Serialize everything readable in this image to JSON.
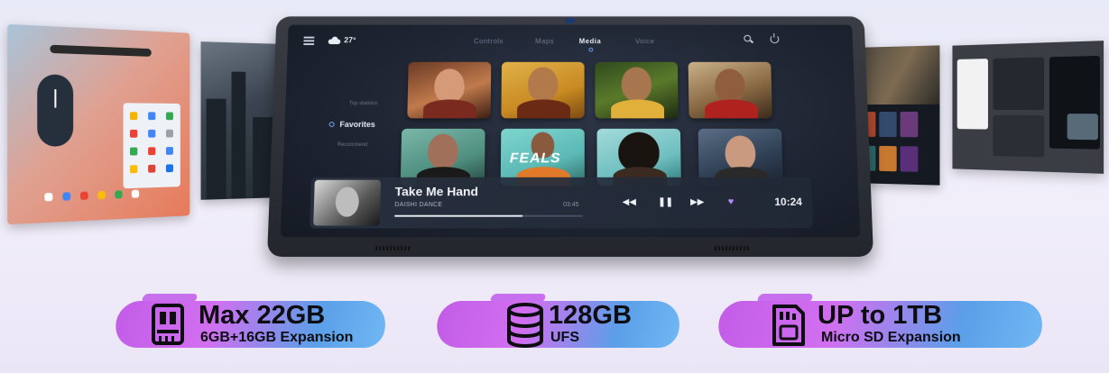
{
  "tablet": {
    "status": {
      "temperature": "27°"
    },
    "tabs": [
      {
        "label": "Controls"
      },
      {
        "label": "Maps"
      },
      {
        "label": "Media"
      },
      {
        "label": "Voice"
      }
    ],
    "active_tab": "Media",
    "nav": [
      {
        "label": "Top stations"
      },
      {
        "label": "Favorites"
      },
      {
        "label": "Recommend"
      }
    ],
    "active_nav": "Favorites",
    "albums": [
      {
        "caption": ""
      },
      {
        "caption": ""
      },
      {
        "caption": ""
      },
      {
        "caption": ""
      },
      {
        "caption": ""
      },
      {
        "caption": "FEALS"
      },
      {
        "caption": ""
      },
      {
        "caption": ""
      }
    ],
    "now_playing": {
      "title": "Take Me Hand",
      "artist": "DAISHI DANCE",
      "time": "03:45",
      "progress_fraction": 0.68,
      "clock": "10:24"
    },
    "icons": [
      "menu-icon",
      "weather-icon",
      "search-icon",
      "power-icon",
      "previous-icon",
      "pause-icon",
      "next-icon",
      "heart-icon"
    ]
  },
  "specs": [
    {
      "main": "Max 22GB",
      "sub": "6GB+16GB Expansion",
      "icon": "ram-chip-icon"
    },
    {
      "main": "128GB",
      "sub": "UFS",
      "icon": "storage-database-icon"
    },
    {
      "main": "UP to 1TB",
      "sub": "Micro SD Expansion",
      "icon": "sd-card-icon"
    }
  ],
  "colors": {
    "accent_purple": "#c35de8",
    "accent_blue": "#5b9fe8",
    "screen_bg": "#1d2330",
    "heart": "#b68cff"
  }
}
